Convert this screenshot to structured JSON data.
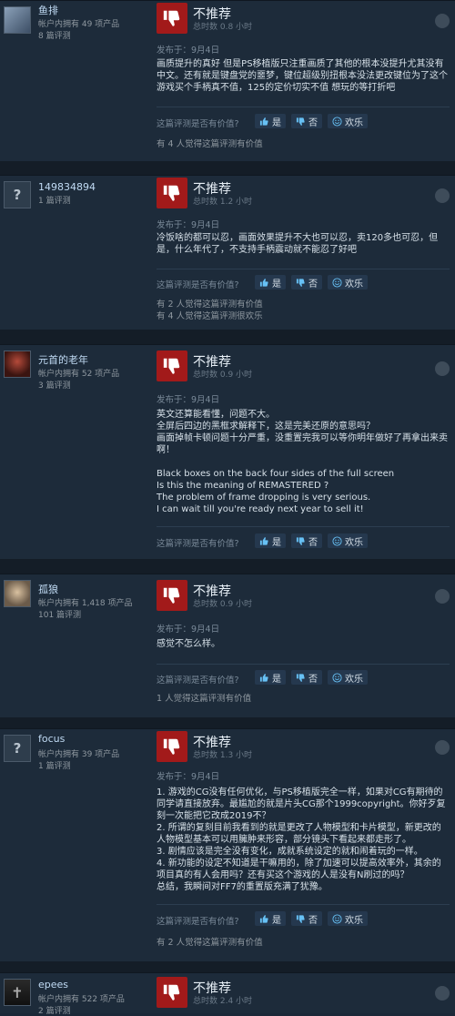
{
  "common": {
    "vote_title": "不推荐",
    "helpful_prompt": "这篇评测是否有价值?",
    "yes_label": "是",
    "no_label": "否",
    "funny_label": "欢乐",
    "posted": "发布于：9月4日"
  },
  "reviews": [
    {
      "author": "鱼排",
      "products": "帐户内拥有 49 项产品",
      "review_count": "8 篇评测",
      "playtime": "总时数 0.8 小时",
      "body": "画质提升的真好 但是PS移植版只注重画质了其他的根本没提升尤其没有中文。还有就是键盘党的噩梦，键位超级别扭根本没法更改键位为了这个游戏买个手柄真不值，125的定价切实不值 想玩的等打折吧",
      "counts": [
        "有 4 人觉得这篇评测有价值"
      ]
    },
    {
      "author": "149834894",
      "products": "",
      "review_count": "1 篇评测",
      "playtime": "总时数 1.2 小时",
      "body": "冷饭啥的都可以忍，画面效果提升不大也可以忍，卖120多也可忍，但是，什么年代了，不支持手柄震动就不能忍了好吧",
      "counts": [
        "有 2 人觉得这篇评测有价值",
        "有 4 人觉得这篇评测很欢乐"
      ]
    },
    {
      "author": "元首的老年",
      "products": "帐户内拥有 52 项产品",
      "review_count": "3 篇评测",
      "playtime": "总时数 0.9 小时",
      "body": "英文还算能看懂，问题不大。\n全屏后四边的黑框求解释下，这是完美还原的意思吗？\n画面掉帧卡顿问题十分严重，没重置完我可以等你明年做好了再拿出来卖啊！\n\nBlack boxes on the back four sides of the full screen\nIs this the meaning of REMASTERED ?\nThe problem of frame dropping is very serious.\nI can wait till you're ready next year to sell it!",
      "counts": []
    },
    {
      "author": "孤狼",
      "products": "帐户内拥有 1,418 项产品",
      "review_count": "101 篇评测",
      "playtime": "总时数 0.9 小时",
      "body": "感觉不怎么样。",
      "counts": [
        "1 人觉得这篇评测有价值"
      ]
    },
    {
      "author": "focus",
      "products": "帐户内拥有 39 项产品",
      "review_count": "1 篇评测",
      "playtime": "总时数 1.3 小时",
      "body": "1. 游戏的CG没有任何优化，与PS移植版完全一样，如果对CG有期待的同学请直接放弃。最尴尬的就是片头CG那个1999copyright。你好歹复刻一次能把它改成2019不？\n2. 所谓的复刻目前我看到的就是更改了人物模型和卡片模型，新更改的人物模型基本可以用臃肿来形容，部分镜头下看起来都走形了。\n3. 剧情应该是完全没有变化，成就系统设定的就和闹着玩的一样。\n4. 新功能的设定不知道是干嘛用的，除了加速可以提高效率外，其余的项目真的有人会用吗？还有买这个游戏的人是没有N刷过的吗？\n总结，我瞬间对FF7的重置版充满了犹豫。",
      "counts": [
        "有 2 人觉得这篇评测有价值"
      ]
    },
    {
      "author": "epees",
      "products": "帐户内拥有 522 项产品",
      "review_count": "2 篇评测",
      "playtime": "总时数 2.4 小时",
      "body": "",
      "counts": []
    }
  ]
}
